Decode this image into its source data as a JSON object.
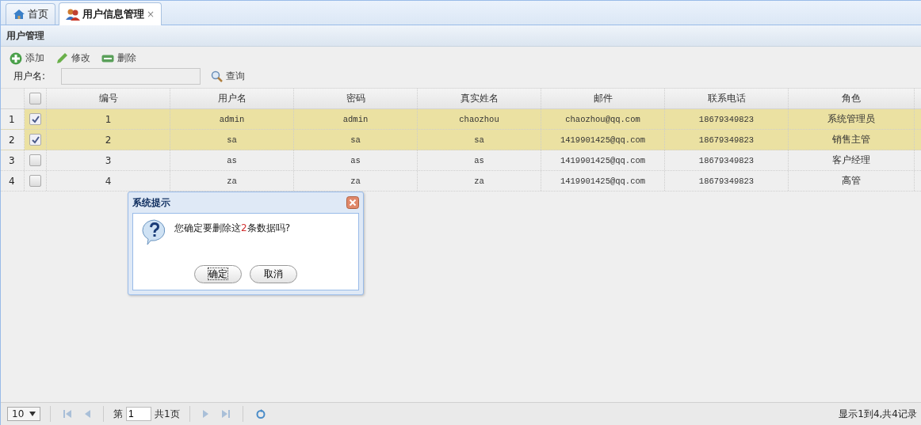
{
  "tabs": [
    {
      "label": "首页",
      "selected": false
    },
    {
      "label": "用户信息管理",
      "selected": true,
      "close": "×"
    }
  ],
  "panel": {
    "title": "用户管理"
  },
  "toolbar": [
    {
      "label": "添加"
    },
    {
      "label": "修改"
    },
    {
      "label": "删除"
    }
  ],
  "search": {
    "label": "用户名:",
    "button": "查询"
  },
  "table": {
    "columns": [
      "编号",
      "用户名",
      "密码",
      "真实姓名",
      "邮件",
      "联系电话",
      "角色"
    ],
    "header_checked": false,
    "rows": [
      {
        "row_number": "1",
        "checked": true,
        "cells": [
          "1",
          "admin",
          "admin",
          "chaozhou",
          "chaozhou@qq.com",
          "18679349823",
          "系统管理员"
        ]
      },
      {
        "row_number": "2",
        "checked": true,
        "cells": [
          "2",
          "sa",
          "sa",
          "sa",
          "1419901425@qq.com",
          "18679349823",
          "销售主管"
        ]
      },
      {
        "row_number": "3",
        "checked": false,
        "cells": [
          "3",
          "as",
          "as",
          "as",
          "1419901425@qq.com",
          "18679349823",
          "客户经理"
        ]
      },
      {
        "row_number": "4",
        "checked": false,
        "cells": [
          "4",
          "za",
          "za",
          "za",
          "1419901425@qq.com",
          "18679349823",
          "高管"
        ]
      }
    ]
  },
  "dialog": {
    "title": "系统提示",
    "message_before": "您确定要删除这",
    "count": "2",
    "message_after": "条数据吗?",
    "buttons": [
      {
        "label": "确定",
        "focused": true
      },
      {
        "label": "取消",
        "focused": false
      }
    ]
  },
  "pager": {
    "page_size": "10",
    "page_label": "第",
    "page": "1",
    "total_pages": "共1页",
    "summary": "显示1到4,共4记录"
  }
}
